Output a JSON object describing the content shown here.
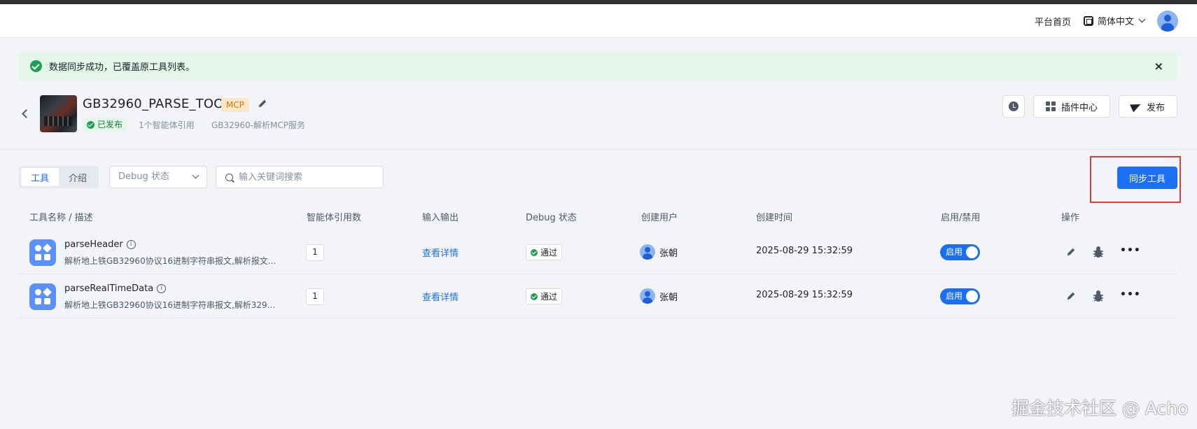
{
  "topbar": {
    "home_label": "平台首页",
    "language_label": "简体中文"
  },
  "alert": {
    "message": "数据同步成功，已覆盖原工具列表。",
    "close_label": "×"
  },
  "header": {
    "title": "GB32960_PARSE_TOOL",
    "type_tag": "MCP",
    "status": "已发布",
    "ref_count_text": "1个智能体引用",
    "description": "GB32960-解析MCP服务",
    "plugin_center_label": "插件中心",
    "publish_label": "发布"
  },
  "toolbar": {
    "tabs": [
      {
        "label": "工具",
        "active": true
      },
      {
        "label": "介绍",
        "active": false
      }
    ],
    "debug_select_value": "Debug 状态",
    "search_placeholder": "输入关键词搜索",
    "sync_button_label": "同步工具"
  },
  "table": {
    "headers": [
      "工具名称 / 描述",
      "智能体引用数",
      "输入输出",
      "Debug 状态",
      "创建用户",
      "创建时间",
      "启用/禁用",
      "操作"
    ],
    "rows": [
      {
        "name": "parseHeader",
        "description": "解析地上铁GB32960协议16进制字符串报文,解析报文...",
        "ref_count": "1",
        "io_link": "查看详情",
        "debug_status": "通过",
        "user": "张朝",
        "created_at": "2025-08-29 15:32:59",
        "toggle_label": "启用",
        "enabled": true
      },
      {
        "name": "parseRealTimeData",
        "description": "解析地上铁GB32960协议16进制字符串报文,解析329...",
        "ref_count": "1",
        "io_link": "查看详情",
        "debug_status": "通过",
        "user": "张朝",
        "created_at": "2025-08-29 15:32:59",
        "toggle_label": "启用",
        "enabled": true
      }
    ]
  },
  "watermark": "掘金技术社区 @ Acho",
  "colors": {
    "primary": "#1d6ff2",
    "success": "#1f9d55",
    "success_bg": "#e3f6e9",
    "mcp_tag_bg": "#fbe7c8",
    "mcp_tag_text": "#c77713",
    "highlight_box": "#e03c3c",
    "page_bg": "#f2f4f7"
  }
}
